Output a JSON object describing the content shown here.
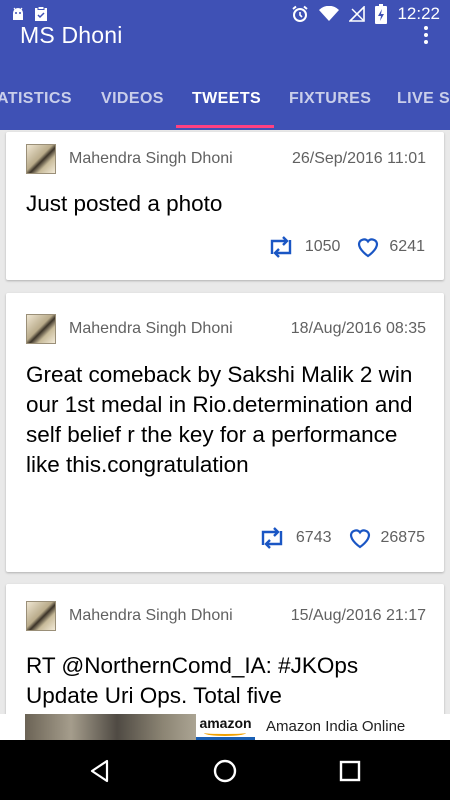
{
  "status_bar": {
    "time": "12:22",
    "icons": [
      "android-debug-icon",
      "clipboard-icon",
      "alarm-icon",
      "wifi-icon",
      "no-sim-icon",
      "battery-charging-icon"
    ]
  },
  "app": {
    "title": "MS Dhoni",
    "colors": {
      "primary": "#3f51b5",
      "accent": "#ff4081",
      "retweet": "#1a56c4"
    }
  },
  "tabs": [
    {
      "label": "ATISTICS",
      "active": false
    },
    {
      "label": "VIDEOS",
      "active": false
    },
    {
      "label": "TWEETS",
      "active": true
    },
    {
      "label": "FIXTURES",
      "active": false
    },
    {
      "label": "LIVE SC",
      "active": false
    }
  ],
  "tweets": [
    {
      "author": "Mahendra Singh Dhoni",
      "date": "26/Sep/2016 11:01",
      "text": "Just posted a photo",
      "retweets": "1050",
      "likes": "6241"
    },
    {
      "author": "Mahendra Singh Dhoni",
      "date": "18/Aug/2016 08:35",
      "text": "Great comeback by Sakshi Malik 2 win our 1st medal in Rio.determination and self belief r the key for a performance like this.congratulation",
      "retweets": "6743",
      "likes": "26875"
    },
    {
      "author": "Mahendra Singh Dhoni",
      "date": "15/Aug/2016 21:17",
      "text": "RT @NorthernComd_IA: #JKOps Update Uri Ops. Total five",
      "retweets": "",
      "likes": ""
    }
  ],
  "ad": {
    "brand": "amazon",
    "text": "Amazon India Online"
  },
  "nav": {
    "icons": [
      "back-icon",
      "home-icon",
      "recents-icon"
    ]
  }
}
